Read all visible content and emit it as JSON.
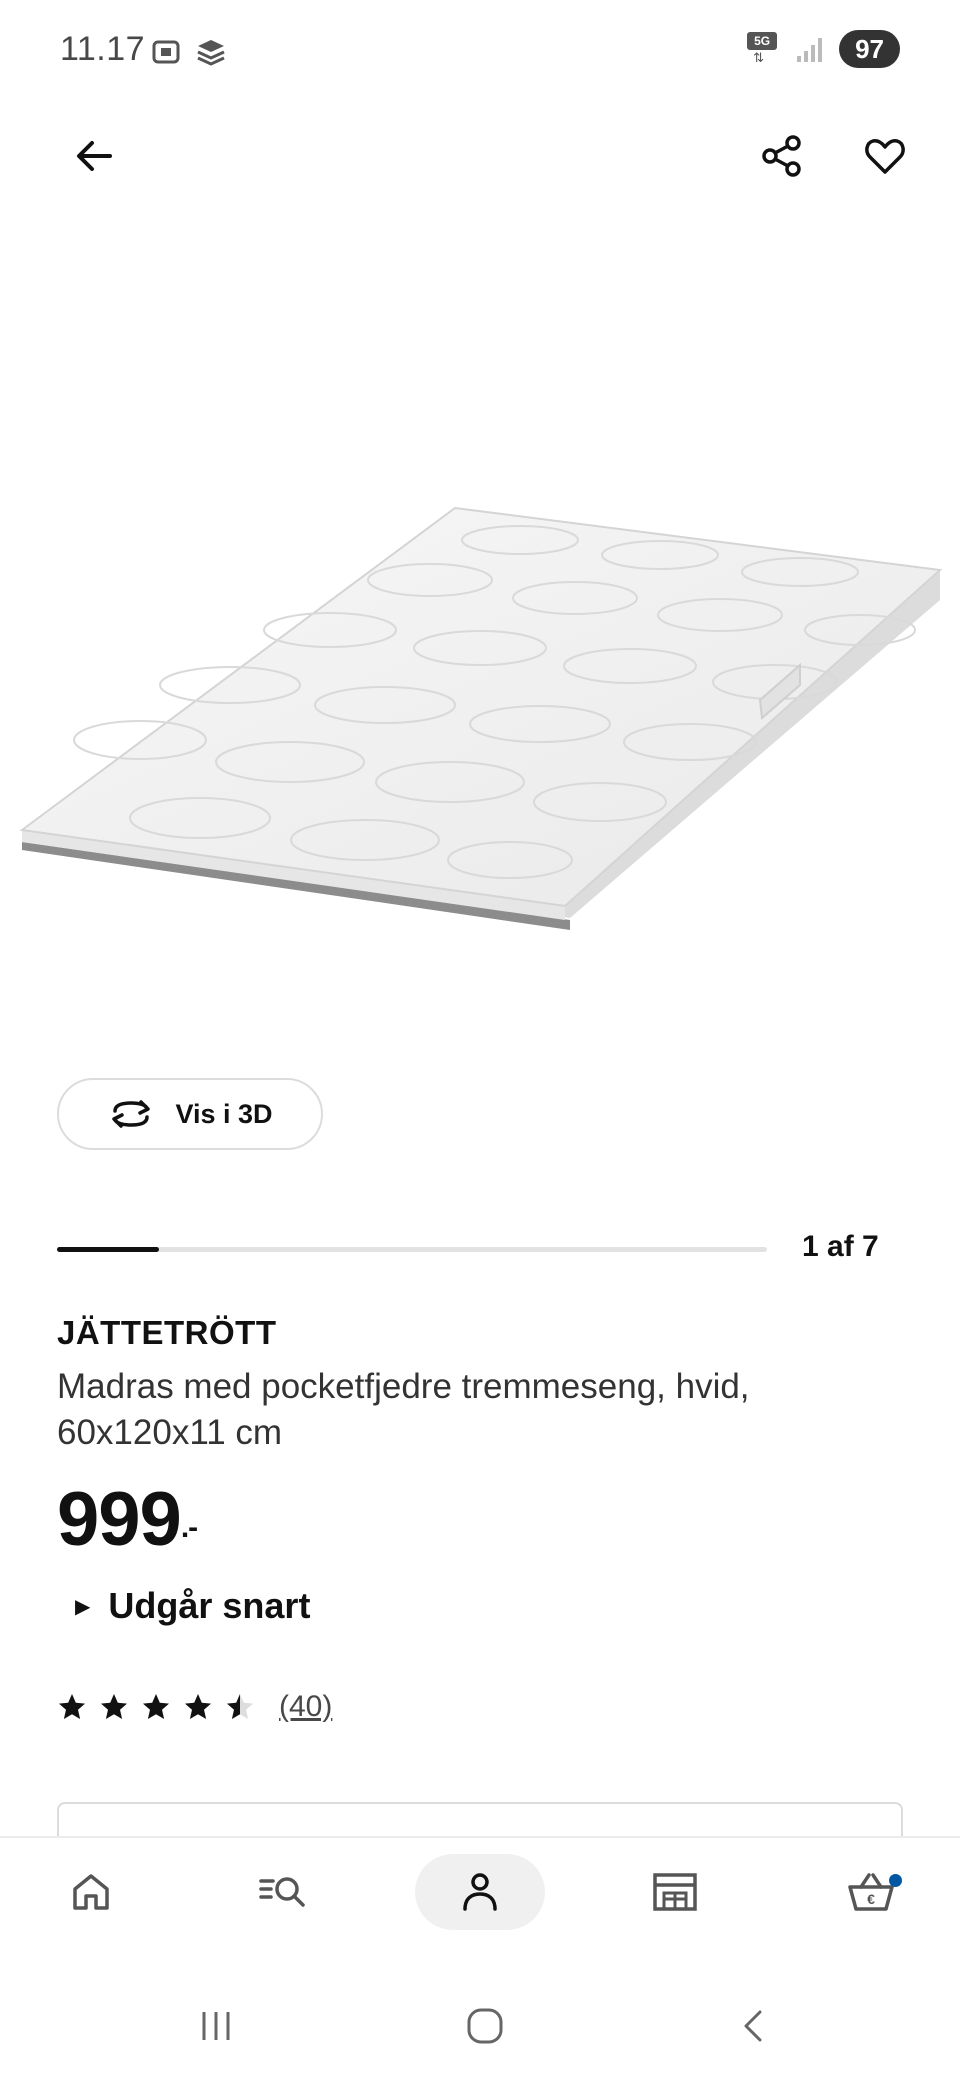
{
  "status_bar": {
    "time": "11.17",
    "network_label": "5G",
    "battery": "97"
  },
  "product": {
    "name": "JÄTTETRÖTT",
    "description": "Madras med pocketfjedre tremmeseng, hvid, 60x120x11 cm",
    "price_main": "999",
    "price_suffix": ".-",
    "availability": "Udgår snart",
    "rating_value": 4.5,
    "rating_max": 5,
    "review_count": "(40)"
  },
  "gallery": {
    "view_3d_label": "Vis i 3D",
    "image_counter": "1 af 7",
    "progress_fraction": 0.143
  },
  "bottom_nav": {
    "items": [
      {
        "icon": "home-icon"
      },
      {
        "icon": "search-list-icon"
      },
      {
        "icon": "profile-icon",
        "active": true
      },
      {
        "icon": "store-icon"
      },
      {
        "icon": "basket-icon"
      }
    ]
  },
  "colors": {
    "accent_blue": "#0058a3",
    "text_dark": "#111111"
  }
}
